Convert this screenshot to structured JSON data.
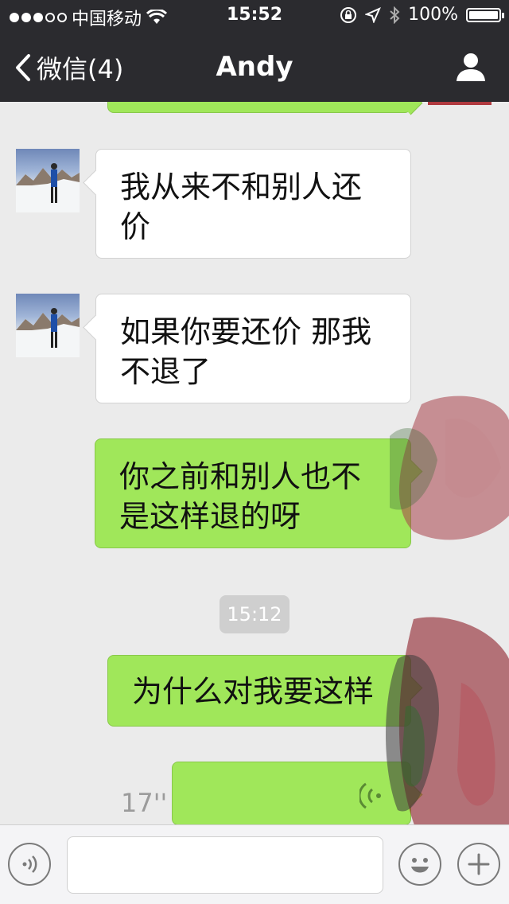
{
  "status_bar": {
    "carrier": "中国移动",
    "time": "15:52",
    "battery": "100%"
  },
  "nav": {
    "back_label": "微信(4)",
    "title": "Andy"
  },
  "messages": [
    {
      "side": "in",
      "text": "我从来不和别人还价"
    },
    {
      "side": "in",
      "text": "如果你要还价 那我不退了"
    },
    {
      "side": "out",
      "text": "你之前和别人也不是这样退的呀"
    },
    {
      "side": "out",
      "text": "为什么对我要这样"
    },
    {
      "side": "out",
      "type": "voice",
      "duration": "17''"
    }
  ],
  "timestamp": "15:12",
  "colors": {
    "nav_bg": "#2b2b2f",
    "chat_bg": "#ebebeb",
    "out_bubble": "#a0e75a",
    "in_bubble": "#ffffff"
  },
  "icons": {
    "back": "chevron-left-icon",
    "profile": "person-icon",
    "voice_mode": "voice-wave-icon",
    "emoji": "smiley-icon",
    "more": "plus-icon"
  }
}
